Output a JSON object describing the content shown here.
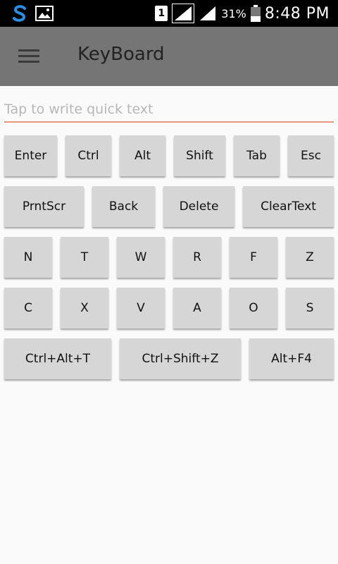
{
  "status_bar": {
    "sim_slot": "1",
    "battery_percent": "31%",
    "time": "8:48 PM",
    "icons": [
      "skype-icon",
      "gallery-icon",
      "sim-icon",
      "signal-icon",
      "battery-icon"
    ]
  },
  "app_bar": {
    "title": "KeyBoard",
    "menu_icon": "hamburger-menu-icon"
  },
  "input": {
    "placeholder": "Tap to write quick text",
    "value": ""
  },
  "keys": {
    "row1": [
      "Enter",
      "Ctrl",
      "Alt",
      "Shift",
      "Tab",
      "Esc"
    ],
    "row2": [
      "PrntScr",
      "Back",
      "Delete",
      "ClearText"
    ],
    "row3": [
      "N",
      "T",
      "W",
      "R",
      "F",
      "Z"
    ],
    "row4": [
      "C",
      "X",
      "V",
      "A",
      "O",
      "S"
    ],
    "row5": [
      "Ctrl+Alt+T",
      "Ctrl+Shift+Z",
      "Alt+F4"
    ]
  },
  "colors": {
    "app_bar": "#757575",
    "input_underline": "#e8967a",
    "key_background": "#d6d6d6",
    "page_background": "#fafafa"
  }
}
